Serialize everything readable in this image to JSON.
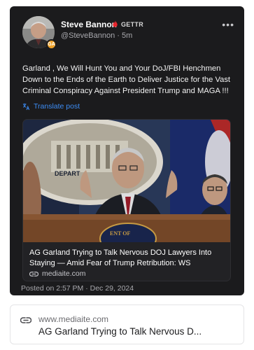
{
  "post": {
    "author": {
      "display_name": "Steve Bannon",
      "platform": "GETTR",
      "handle": "@SteveBannon",
      "time_ago": "5m",
      "handle_line": "@SteveBannon · 5m",
      "avatar_badge": "GA"
    },
    "text": "Garland , We Will Hunt You and Your DoJ/FBI Henchmen Down to the Ends of the Earth to Deliver Justice for the Vast Criminal Conspiracy Against President Trump and MAGA !!!",
    "translate_label": "Translate post",
    "media": {
      "image_label": "Image: Merrick Garland speaking at a podium at the Department of Justice",
      "headline": "AG Garland Trying to Talk Nervous DOJ Lawyers Into Staying — Amid Fear of Trump Retribution: WS",
      "domain": "mediaite.com"
    },
    "posted_at": "Posted on 2:57 PM · Dec 29, 2024"
  },
  "link_preview": {
    "domain": "www.mediaite.com",
    "title": "AG Garland Trying to Talk Nervous D..."
  },
  "colors": {
    "card_bg": "#1b1b1d",
    "accent_blue": "#3d8df5",
    "verified_red": "#e8242c",
    "badge_orange": "#f0a32a"
  },
  "icons": [
    "verified-icon",
    "more-options-icon",
    "translate-icon",
    "link-icon"
  ]
}
